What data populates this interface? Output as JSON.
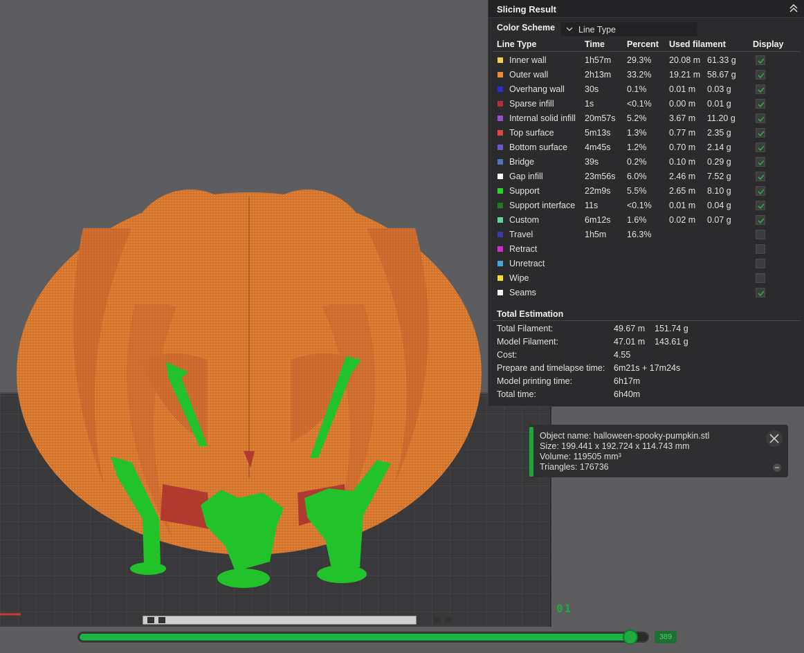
{
  "slicing_result": {
    "title": "Slicing Result",
    "color_scheme_label": "Color Scheme",
    "color_scheme_value": "Line Type",
    "columns": {
      "line_type": "Line Type",
      "time": "Time",
      "percent": "Percent",
      "used_filament": "Used filament",
      "display": "Display"
    },
    "rows": [
      {
        "name": "Inner wall",
        "color": "#f0d050",
        "time": "1h57m",
        "percent": "29.3%",
        "meters": "20.08 m",
        "grams": "61.33 g",
        "checked": true
      },
      {
        "name": "Outer wall",
        "color": "#ef8a3a",
        "time": "2h13m",
        "percent": "33.2%",
        "meters": "19.21 m",
        "grams": "58.67 g",
        "checked": true
      },
      {
        "name": "Overhang wall",
        "color": "#2a2ad0",
        "time": "30s",
        "percent": "0.1%",
        "meters": "0.01 m",
        "grams": "0.03 g",
        "checked": true
      },
      {
        "name": "Sparse infill",
        "color": "#b03030",
        "time": "1s",
        "percent": "<0.1%",
        "meters": "0.00 m",
        "grams": "0.01 g",
        "checked": true
      },
      {
        "name": "Internal solid infill",
        "color": "#9a50c8",
        "time": "20m57s",
        "percent": "5.2%",
        "meters": "3.67 m",
        "grams": "11.20 g",
        "checked": true
      },
      {
        "name": "Top surface",
        "color": "#e04848",
        "time": "5m13s",
        "percent": "1.3%",
        "meters": "0.77 m",
        "grams": "2.35 g",
        "checked": true
      },
      {
        "name": "Bottom surface",
        "color": "#6a5acd",
        "time": "4m45s",
        "percent": "1.2%",
        "meters": "0.70 m",
        "grams": "2.14 g",
        "checked": true
      },
      {
        "name": "Bridge",
        "color": "#4a78b8",
        "time": "39s",
        "percent": "0.2%",
        "meters": "0.10 m",
        "grams": "0.29 g",
        "checked": true
      },
      {
        "name": "Gap infill",
        "color": "#ffffff",
        "time": "23m56s",
        "percent": "6.0%",
        "meters": "2.46 m",
        "grams": "7.52 g",
        "checked": true
      },
      {
        "name": "Support",
        "color": "#28d428",
        "time": "22m9s",
        "percent": "5.5%",
        "meters": "2.65 m",
        "grams": "8.10 g",
        "checked": true
      },
      {
        "name": "Support interface",
        "color": "#1e7a1e",
        "time": "11s",
        "percent": "<0.1%",
        "meters": "0.01 m",
        "grams": "0.04 g",
        "checked": true
      },
      {
        "name": "Custom",
        "color": "#5ed39a",
        "time": "6m12s",
        "percent": "1.6%",
        "meters": "0.02 m",
        "grams": "0.07 g",
        "checked": true
      },
      {
        "name": "Travel",
        "color": "#3a3ab0",
        "time": "1h5m",
        "percent": "16.3%",
        "meters": "",
        "grams": "",
        "checked": false
      },
      {
        "name": "Retract",
        "color": "#cc30cc",
        "time": "",
        "percent": "",
        "meters": "",
        "grams": "",
        "checked": false
      },
      {
        "name": "Unretract",
        "color": "#40a8d8",
        "time": "",
        "percent": "",
        "meters": "",
        "grams": "",
        "checked": false
      },
      {
        "name": "Wipe",
        "color": "#f0e030",
        "time": "",
        "percent": "",
        "meters": "",
        "grams": "",
        "checked": false
      },
      {
        "name": "Seams",
        "color": "#f2f2f2",
        "time": "",
        "percent": "",
        "meters": "",
        "grams": "",
        "checked": true
      }
    ],
    "total_estimation": {
      "title": "Total Estimation",
      "rows": [
        {
          "label": "Total Filament:",
          "v1": "49.67 m",
          "v2": "151.74 g"
        },
        {
          "label": "Model Filament:",
          "v1": "47.01 m",
          "v2": "143.61 g"
        },
        {
          "label": "Cost:",
          "v1": "4.55",
          "v2": ""
        },
        {
          "label": "Prepare and timelapse time:",
          "v1": "6m21s + 17m24s",
          "v2": ""
        },
        {
          "label": "Model printing time:",
          "v1": "6h17m",
          "v2": ""
        },
        {
          "label": "Total time:",
          "v1": "6h40m",
          "v2": ""
        }
      ]
    }
  },
  "object_info": {
    "name": "Object name: halloween-spooky-pumpkin.stl",
    "size": "Size: 199.441 x 192.724 x 114.743 mm",
    "volume": "Volume: 119505 mm³",
    "triangles": "Triangles: 176736"
  },
  "layer_slider": {
    "value": "389",
    "fraction": 0.985
  },
  "view_label": "01",
  "colors": {
    "support_green": "#22c22a",
    "model_orange": "#d9772f",
    "accent_green": "#1db343"
  }
}
